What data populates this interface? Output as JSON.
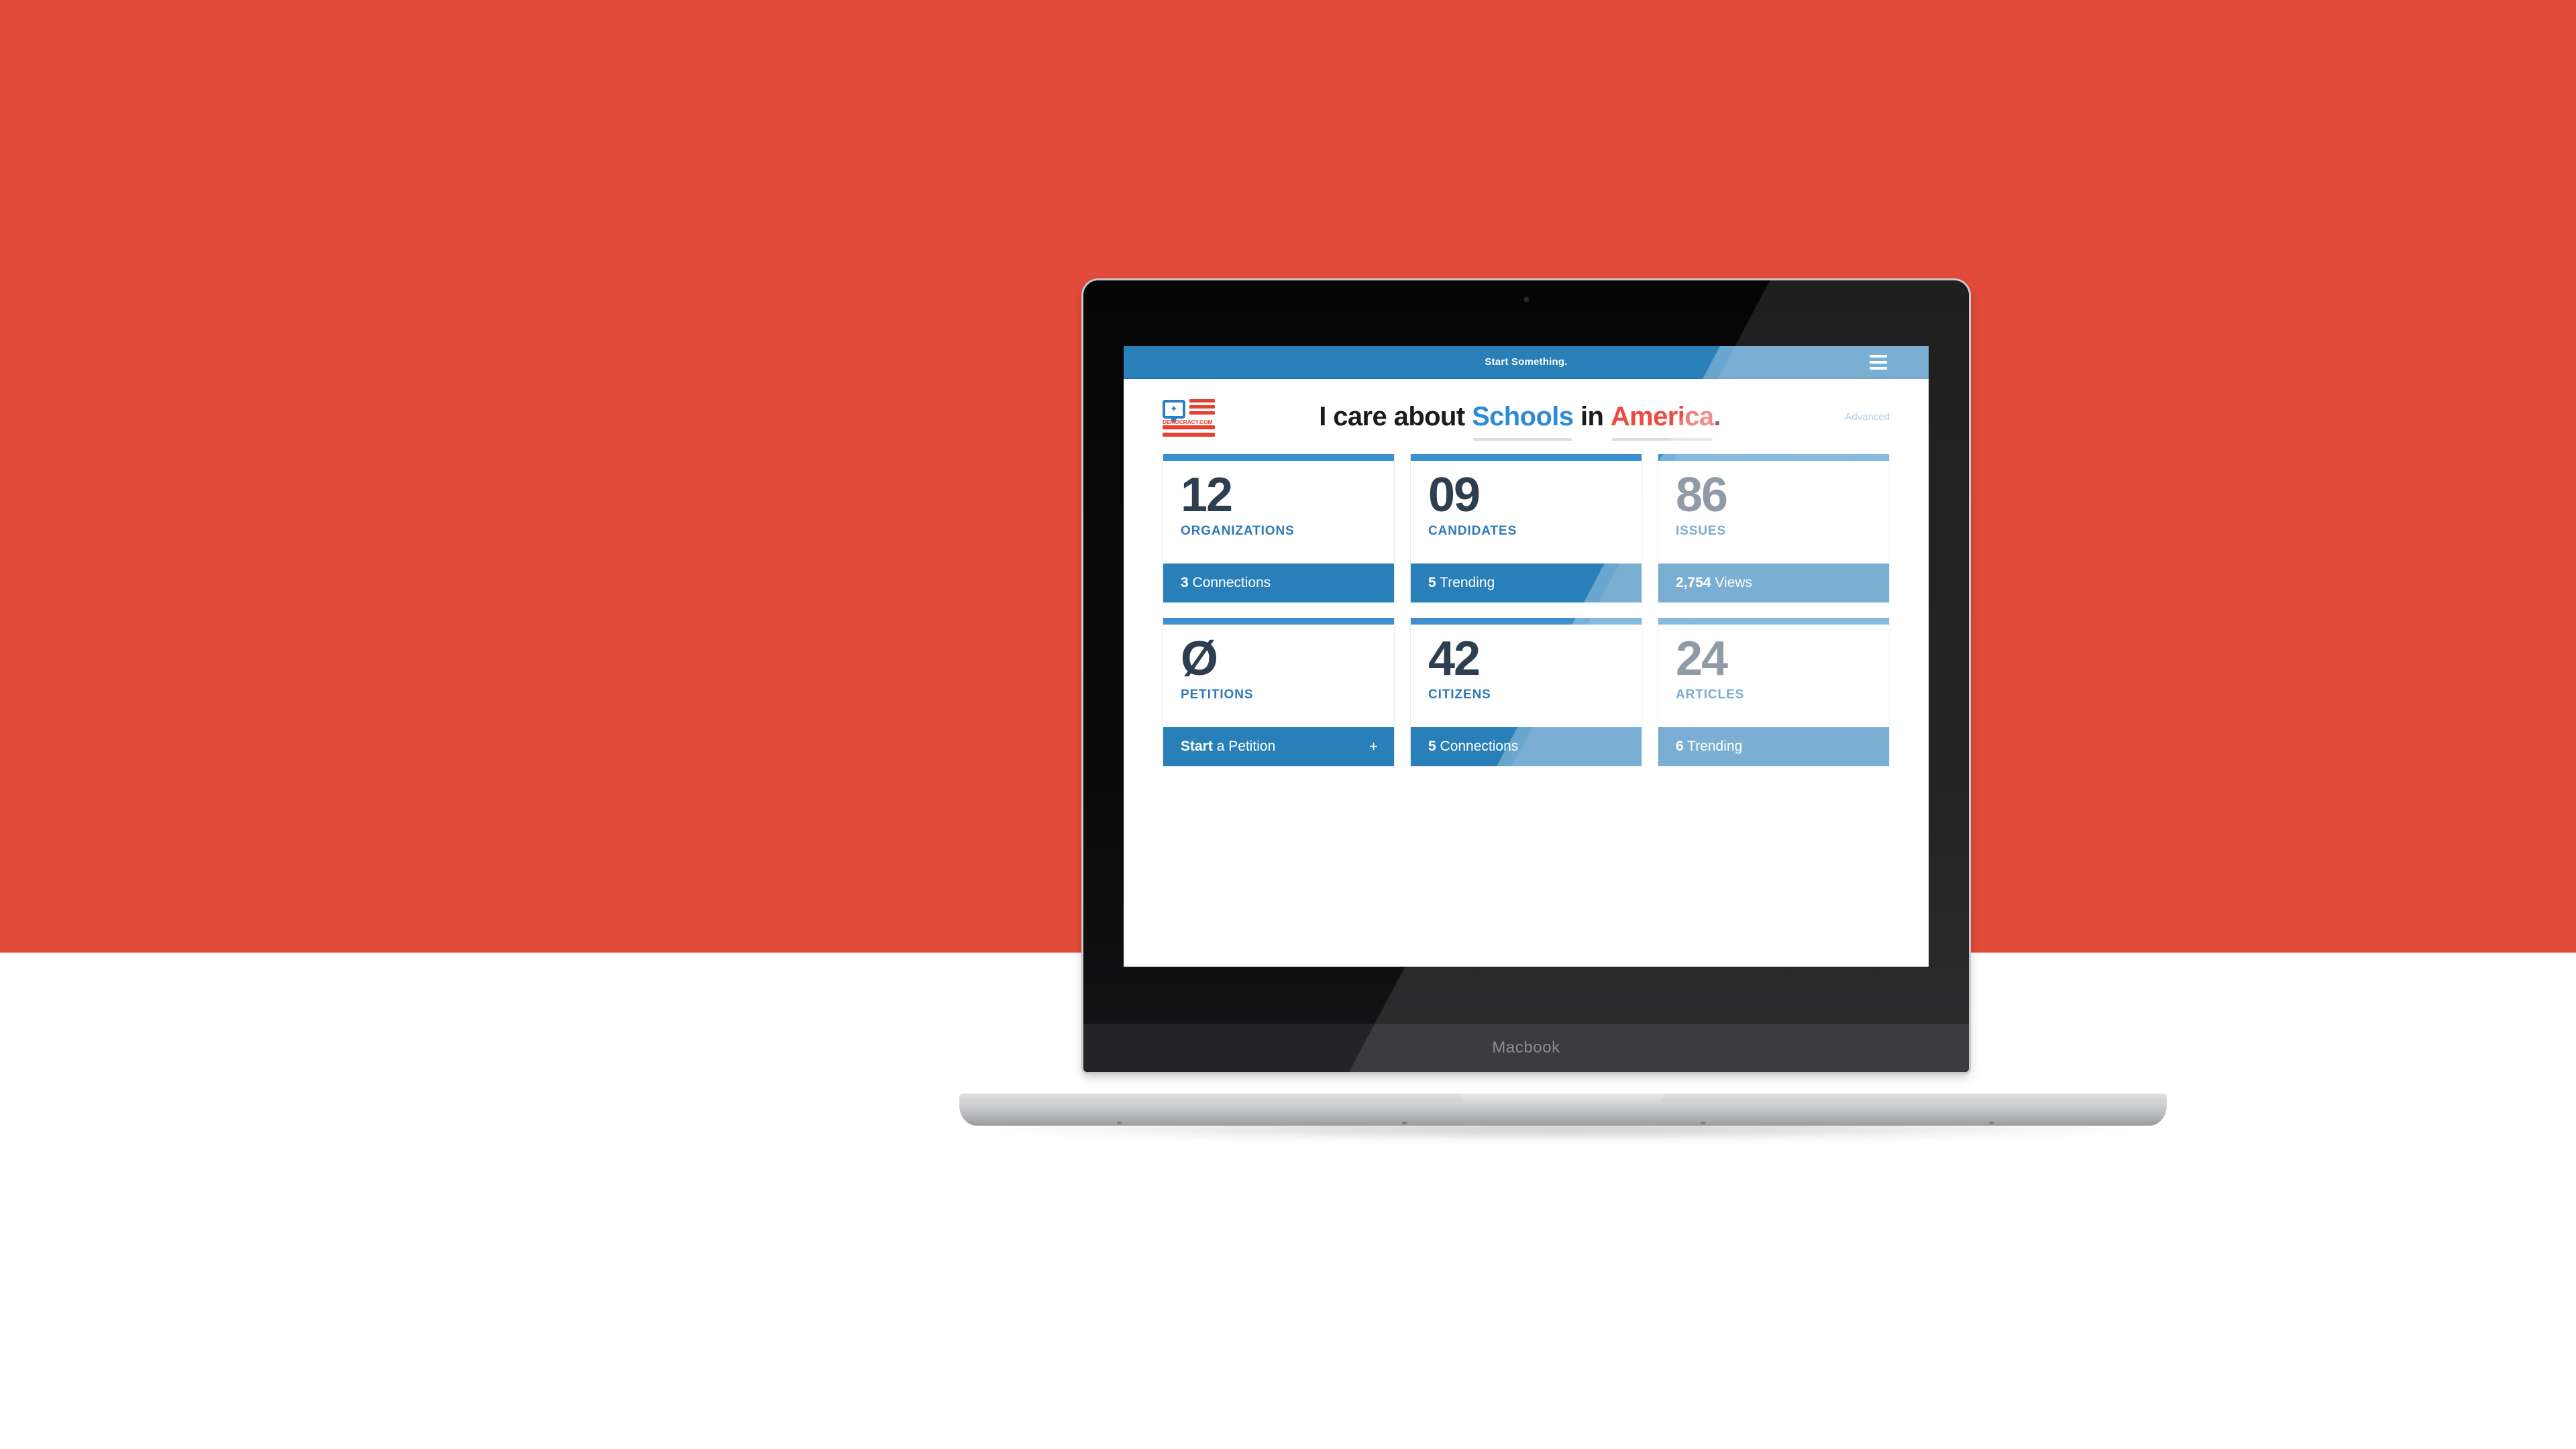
{
  "page": {
    "background_color": "#E34B3A",
    "lower_background_color": "#FFFFFF"
  },
  "device": {
    "brand_label": "Macbook",
    "camera_icon": "camera-icon"
  },
  "site": {
    "topbar": {
      "tagline": "Start Something.",
      "menu_icon": "hamburger-menu-icon"
    },
    "logo": {
      "wordmark": "DEMOCRACY.COM",
      "bubble_icon": "speech-bubble-icon",
      "star_glyph": "✦",
      "flag_icon": "us-flag-icon"
    },
    "search": {
      "prefix": "I care about",
      "topic": "Schools",
      "connector": "in",
      "place": "America",
      "period": ".",
      "advanced_label": "Advanced",
      "topic_color": "#2C8BD1",
      "place_color": "#ED4B40"
    },
    "cards": [
      {
        "number": "12",
        "label": "ORGANIZATIONS",
        "footer_lead": "3",
        "footer_rest": "Connections",
        "footer_icon": null,
        "muted": false
      },
      {
        "number": "09",
        "label": "CANDIDATES",
        "footer_lead": "5",
        "footer_rest": "Trending",
        "footer_icon": null,
        "muted": false
      },
      {
        "number": "86",
        "label": "ISSUES",
        "footer_lead": "2,754",
        "footer_rest": "Views",
        "footer_icon": null,
        "muted": true
      },
      {
        "number": "Ø",
        "label": "PETITIONS",
        "footer_lead": "Start",
        "footer_rest": "a Petition",
        "footer_icon": "+",
        "muted": false
      },
      {
        "number": "42",
        "label": "CITIZENS",
        "footer_lead": "5",
        "footer_rest": "Connections",
        "footer_icon": null,
        "muted": false
      },
      {
        "number": "24",
        "label": "ARTICLES",
        "footer_lead": "6",
        "footer_rest": "Trending",
        "footer_icon": null,
        "muted": true
      }
    ],
    "colors": {
      "header_blue": "#2980B9",
      "accent_blue": "#3C90CE",
      "label_blue": "#2E78B8",
      "number_navy": "#2D3E50",
      "brand_red": "#E8402E"
    }
  }
}
